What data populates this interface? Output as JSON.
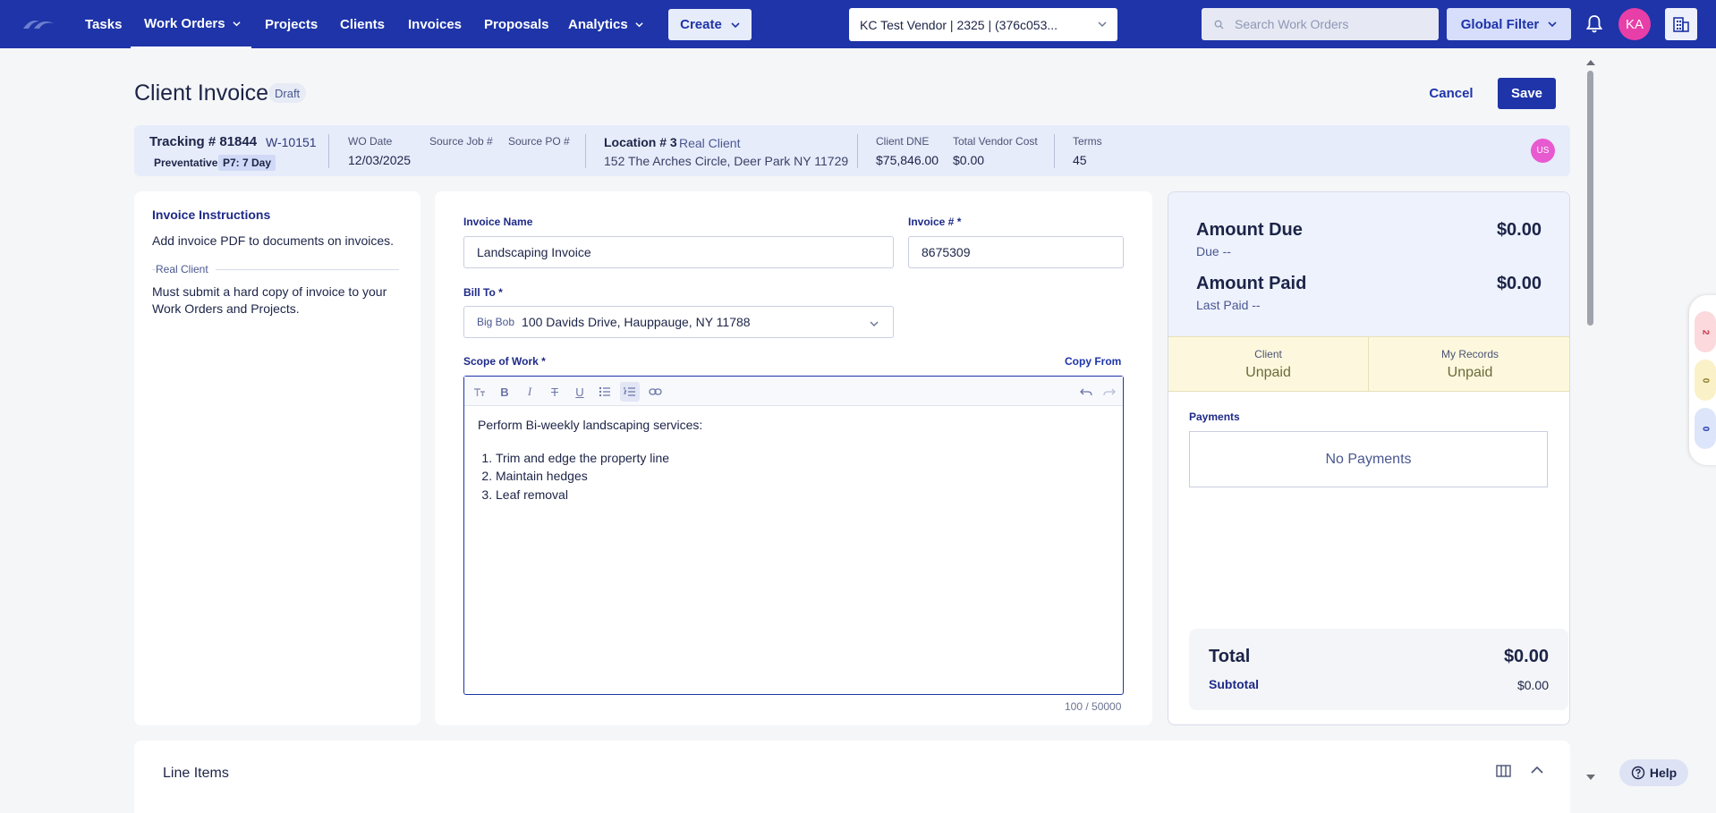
{
  "nav": {
    "items": [
      {
        "label": "Tasks"
      },
      {
        "label": "Work Orders"
      },
      {
        "label": "Projects"
      },
      {
        "label": "Clients"
      },
      {
        "label": "Invoices"
      },
      {
        "label": "Proposals"
      },
      {
        "label": "Analytics"
      }
    ],
    "active": "Work Orders",
    "create_label": "Create",
    "vendor_select": "KC Test Vendor | 2325 | (376c053...",
    "search_placeholder": "Search Work Orders",
    "global_filter_label": "Global Filter",
    "avatar_initials": "KA",
    "brand_color": "#1e34a8"
  },
  "header": {
    "title": "Client Invoice",
    "status_badge": "Draft",
    "cancel_label": "Cancel",
    "save_label": "Save"
  },
  "info": {
    "tracking": "Tracking # 81844",
    "wo_number": "W-10151",
    "tag_type": "Preventative",
    "tag_priority": "P7: 7 Day",
    "wo_date_label": "WO Date",
    "wo_date": "12/03/2025",
    "source_job_label": "Source Job #",
    "source_po_label": "Source PO #",
    "location": "Location # 3",
    "location_client": "Real Client",
    "address": "152 The Arches Circle, Deer Park NY 11729",
    "client_dne_label": "Client DNE",
    "client_dne": "$75,846.00",
    "vendor_cost_label": "Total Vendor Cost",
    "vendor_cost": "$0.00",
    "terms_label": "Terms",
    "terms": "45",
    "user_initials": "US"
  },
  "instructions": {
    "title": "Invoice Instructions",
    "general": "Add invoice PDF to documents on invoices.",
    "client_label": "Real Client",
    "client_line1": "Must submit a hard copy of invoice to your",
    "client_line2": "Work Orders and Projects."
  },
  "form": {
    "invoice_name_label": "Invoice Name",
    "invoice_name": "Landscaping Invoice",
    "invoice_number_label": "Invoice # *",
    "invoice_number": "8675309",
    "bill_to_label": "Bill To *",
    "bill_to_name": "Big Bob",
    "bill_to_address": "100 Davids Drive, Hauppauge, NY 11788",
    "scope_label": "Scope of Work *",
    "copy_from_label": "Copy From",
    "scope_intro": "Perform Bi-weekly landscaping services:",
    "scope_items": [
      "Trim and edge the property line",
      "Maintain hedges",
      "Leaf removal"
    ],
    "char_count": "100 / 50000"
  },
  "summary": {
    "amount_due_label": "Amount Due",
    "amount_due": "$0.00",
    "due_sub": "Due --",
    "amount_paid_label": "Amount Paid",
    "amount_paid": "$0.00",
    "last_paid_sub": "Last Paid --",
    "client_label": "Client",
    "client_status": "Unpaid",
    "records_label": "My Records",
    "records_status": "Unpaid",
    "payments_label": "Payments",
    "no_payments": "No Payments",
    "total_label": "Total",
    "total": "$0.00",
    "subtotal_label": "Subtotal",
    "subtotal": "$0.00"
  },
  "line_items": {
    "title": "Line Items"
  },
  "side_widget": {
    "counts": [
      "2",
      "0",
      "0"
    ]
  },
  "help_label": "Help"
}
